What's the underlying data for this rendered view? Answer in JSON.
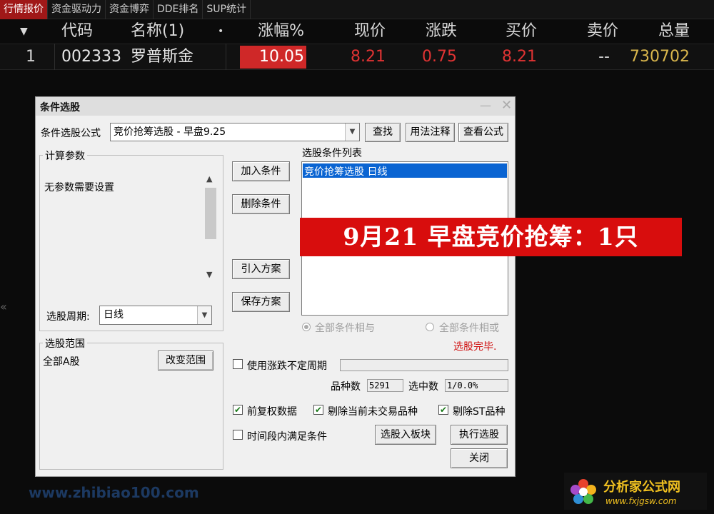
{
  "tabs": [
    "行情报价",
    "资金驱动力",
    "资金博弈",
    "DDE排名",
    "SUP统计"
  ],
  "quote": {
    "headers": {
      "sort": "▼",
      "code": "代码",
      "name": "名称(1)",
      "name_dot": "•",
      "change_pct": "涨幅%",
      "price": "现价",
      "change": "涨跌",
      "bid": "买价",
      "ask": "卖价",
      "volume": "总量"
    },
    "row": {
      "index": "1",
      "code": "002333",
      "name": "罗普斯金",
      "change_pct": "10.05",
      "price": "8.21",
      "change": "0.75",
      "bid": "8.21",
      "ask": "--",
      "volume": "730702"
    }
  },
  "dialog": {
    "title": "条件选股",
    "formula_label": "条件选股公式",
    "formula_value": "竞价抢筹选股  -  早盘9.25",
    "find_button": "查找",
    "usage_button": "用法注释",
    "view_formula_button": "查看公式",
    "calc_params_label": "计算参数",
    "no_params_text": "无参数需要设置",
    "period_label": "选股周期:",
    "period_value": "日线",
    "add_condition": "加入条件",
    "delete_condition": "删除条件",
    "import_plan": "引入方案",
    "save_plan": "保存方案",
    "condition_list_label": "选股条件列表",
    "condition_item": "竞价抢筹选股  日线",
    "all_and": "全部条件相与",
    "all_or": "全部条件相或",
    "status": "选股完毕.",
    "range_label": "选股范围",
    "range_value": "全部A股",
    "change_range": "改变范围",
    "use_indefinite": "使用涨跌不定周期",
    "count_label": "品种数",
    "count_value": "5291",
    "selected_label": "选中数",
    "selected_value": "1/0.0%",
    "adj_data": "前复权数据",
    "exclude_untraded": "剔除当前未交易品种",
    "exclude_st": "剔除ST品种",
    "time_range": "时间段内满足条件",
    "select_to_board": "选股入板块",
    "run_select": "执行选股",
    "close": "关闭"
  },
  "banner": "9月21 早盘竞价抢筹：1只",
  "watermarks": {
    "left": "www.zhibiao100.com",
    "right_cn": "分析家公式网",
    "right_url": "www.fxjgsw.com"
  },
  "colors": {
    "up": "#e03333",
    "volume": "#d9b64d",
    "tab_active": "#a01818",
    "banner": "#d80d0d",
    "selected": "#0a64d2"
  }
}
